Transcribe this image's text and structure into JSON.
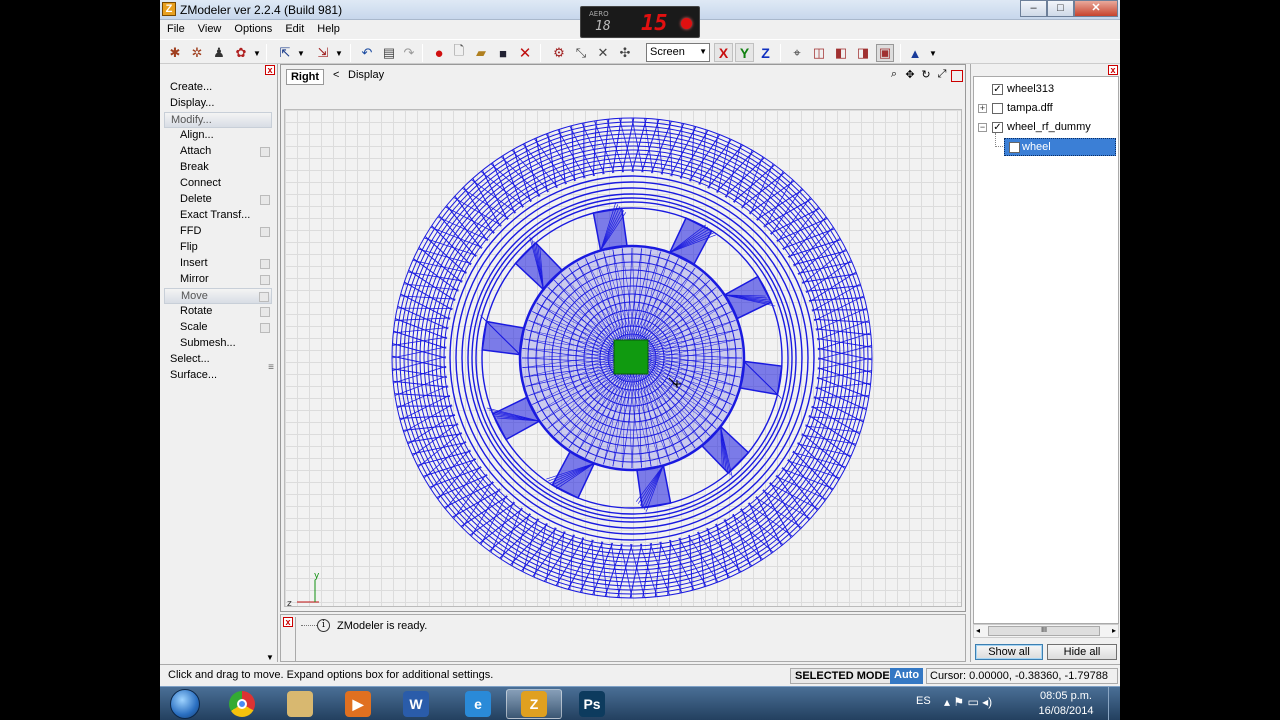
{
  "window": {
    "title": "ZModeler ver 2.2.4 (Build 981)",
    "logo_letter": "Z",
    "minimize_glyph": "–",
    "maximize_glyph": "□",
    "close_glyph": "✕"
  },
  "recorder": {
    "label": "AERO",
    "value_small": "18",
    "value_large": "15"
  },
  "menu": [
    "File",
    "View",
    "Options",
    "Edit",
    "Help"
  ],
  "toolbar": {
    "screen_select": "Screen",
    "axes": [
      {
        "label": "X",
        "color": "#c81010"
      },
      {
        "label": "Y",
        "color": "#108010"
      },
      {
        "label": "Z",
        "color": "#1030c0"
      }
    ]
  },
  "command_panel": {
    "close_glyph": "x",
    "items": [
      {
        "label": "Create...",
        "level": "top"
      },
      {
        "label": "Display...",
        "level": "top"
      },
      {
        "label": "Modify...",
        "level": "top",
        "highlight": true
      },
      {
        "label": "Align...",
        "level": "sub"
      },
      {
        "label": "Attach",
        "level": "sub",
        "box": true
      },
      {
        "label": "Break",
        "level": "sub"
      },
      {
        "label": "Connect",
        "level": "sub"
      },
      {
        "label": "Delete",
        "level": "sub",
        "box": true
      },
      {
        "label": "Exact Transf...",
        "level": "sub"
      },
      {
        "label": "FFD",
        "level": "sub",
        "box": true
      },
      {
        "label": "Flip",
        "level": "sub"
      },
      {
        "label": "Insert",
        "level": "sub",
        "box": true
      },
      {
        "label": "Mirror",
        "level": "sub",
        "box": true
      },
      {
        "label": "Move",
        "level": "sub",
        "box": true,
        "highlight": true
      },
      {
        "label": "Rotate",
        "level": "sub",
        "box": true
      },
      {
        "label": "Scale",
        "level": "sub",
        "box": true
      },
      {
        "label": "Submesh...",
        "level": "sub"
      },
      {
        "label": "Select...",
        "level": "top"
      },
      {
        "label": "Surface...",
        "level": "top"
      }
    ],
    "grip_glyph": "≡",
    "scroll_down_glyph": "▼"
  },
  "viewport": {
    "view_name": "Right",
    "back_arrow": "<",
    "display_label": "Display",
    "axis_y": "y",
    "axis_z": "z",
    "wire_color": "#1a1ae0",
    "selection_color": "#109a10"
  },
  "messages": {
    "close_glyph": "x",
    "info_glyph": "i",
    "text": "ZModeler is ready."
  },
  "tree": {
    "close_glyph": "x",
    "nodes": [
      {
        "label": "wheel313",
        "checked": true,
        "expander": "",
        "indent": 0
      },
      {
        "label": "tampa.dff",
        "checked": false,
        "expander": "+",
        "indent": 0
      },
      {
        "label": "wheel_rf_dummy",
        "checked": true,
        "expander": "−",
        "indent": 0
      },
      {
        "label": "wheel",
        "checked": false,
        "expander": "",
        "indent": 1,
        "selected": true
      }
    ],
    "scroll_left": "◂",
    "scroll_right": "▸",
    "scroll_thumb": "III",
    "show_all": "Show all",
    "hide_all": "Hide all"
  },
  "status": {
    "hint": "Click and drag to move. Expand options box for additional settings.",
    "mode": "SELECTED MODE",
    "auto": "Auto",
    "cursor": "Cursor: 0.00000, -0.38360, -1.79788"
  },
  "taskbar": {
    "apps": [
      {
        "name": "chrome",
        "letter": "",
        "color": "#e0a020"
      },
      {
        "name": "explorer",
        "letter": "",
        "color": "#d8b870"
      },
      {
        "name": "media-player",
        "letter": "▶",
        "color": "#e07020"
      },
      {
        "name": "word",
        "letter": "W",
        "color": "#2a5caa"
      },
      {
        "name": "internet-explorer",
        "letter": "e",
        "color": "#2a8ad8"
      },
      {
        "name": "zmodeler",
        "letter": "Z",
        "color": "#e0a020",
        "active": true
      },
      {
        "name": "photoshop",
        "letter": "Ps",
        "color": "#0d3b5e"
      }
    ],
    "language": "ES",
    "tray_glyphs": "▴ ⚑ ▭ ◂)",
    "time": "08:05 p.m.",
    "date": "16/08/2014"
  }
}
